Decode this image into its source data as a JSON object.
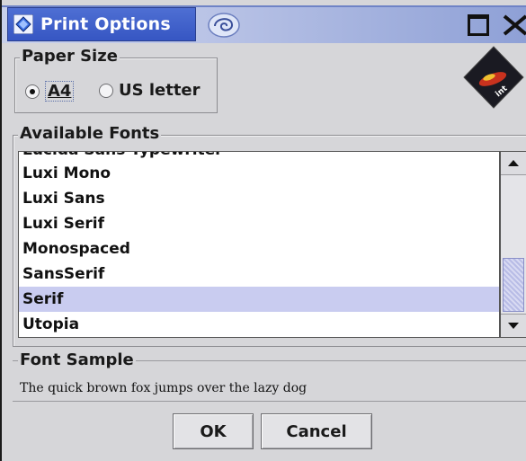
{
  "window": {
    "title": "Print Options"
  },
  "paper_size": {
    "group_label": "Paper Size",
    "options": [
      {
        "label": "A4",
        "selected": true
      },
      {
        "label": "US letter",
        "selected": false
      }
    ]
  },
  "fonts": {
    "group_label": "Available Fonts",
    "partial_item": "Lucida Sans Typewriter",
    "items": [
      {
        "label": "Luxi Mono",
        "selected": false
      },
      {
        "label": "Luxi Sans",
        "selected": false
      },
      {
        "label": "Luxi Serif",
        "selected": false
      },
      {
        "label": "Monospaced",
        "selected": false
      },
      {
        "label": "SansSerif",
        "selected": false
      },
      {
        "label": "Serif",
        "selected": true
      },
      {
        "label": "Utopia",
        "selected": false
      }
    ]
  },
  "sample": {
    "group_label": "Font Sample",
    "text": "The quick brown fox jumps over the lazy dog"
  },
  "buttons": {
    "ok": "OK",
    "cancel": "Cancel"
  },
  "colors": {
    "title_bar": "#3656c3",
    "selection": "#c9ccf0",
    "background": "#d6d6d9"
  },
  "icons": [
    "app-diamond-icon",
    "swirl-icon",
    "maximize-icon",
    "close-icon",
    "integral-logo",
    "scroll-up-icon",
    "scroll-down-icon"
  ]
}
